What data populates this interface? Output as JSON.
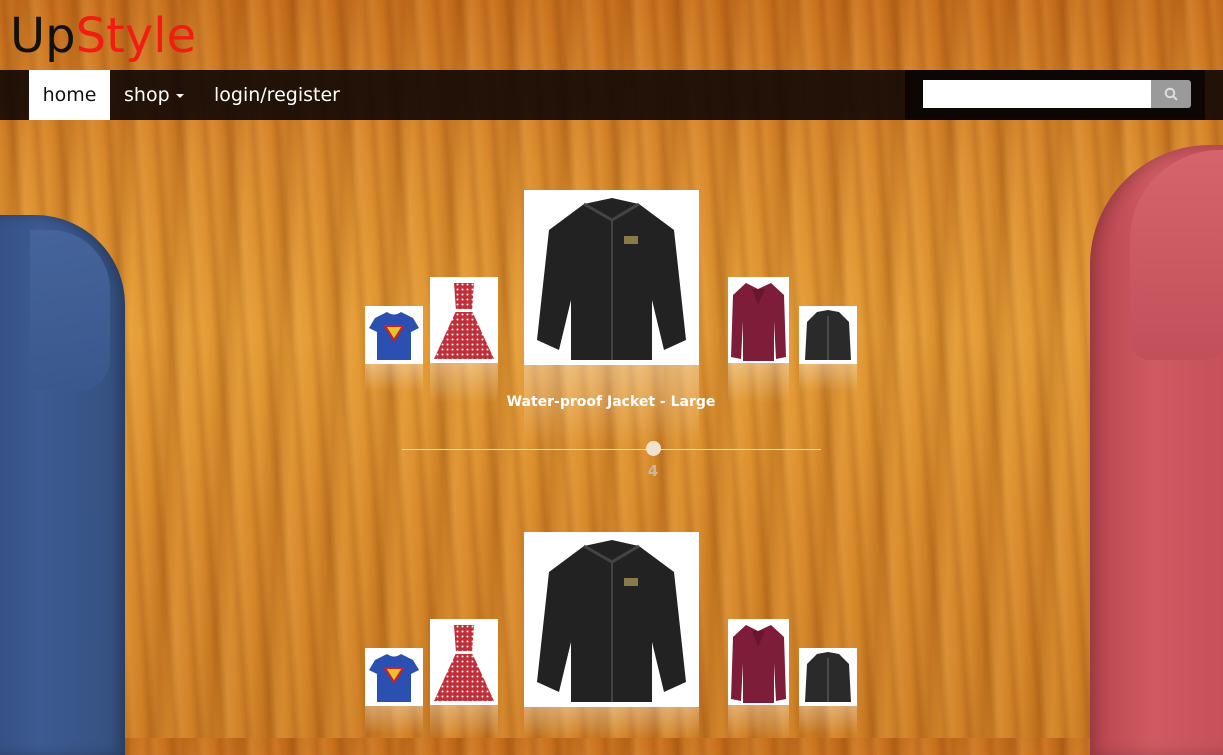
{
  "logo": {
    "part1": "Up",
    "part2": "Style"
  },
  "nav": {
    "home": "home",
    "shop": "shop",
    "login": "login/register"
  },
  "search": {
    "value": "",
    "icon": "search-icon"
  },
  "carousel1": {
    "items": [
      "superman t-shirt",
      "red polka dot dress",
      "black jacket",
      "burgundy blouse",
      "black coat"
    ],
    "caption": "Water-proof Jacket - Large",
    "slider_value": "4"
  },
  "carousel2": {
    "items": [
      "superman t-shirt",
      "red polka dot dress",
      "black jacket",
      "burgundy blouse",
      "black coat"
    ]
  },
  "colors": {
    "accent": "#f21d12",
    "navbar": "#140a05",
    "background": "#d98a2a"
  }
}
